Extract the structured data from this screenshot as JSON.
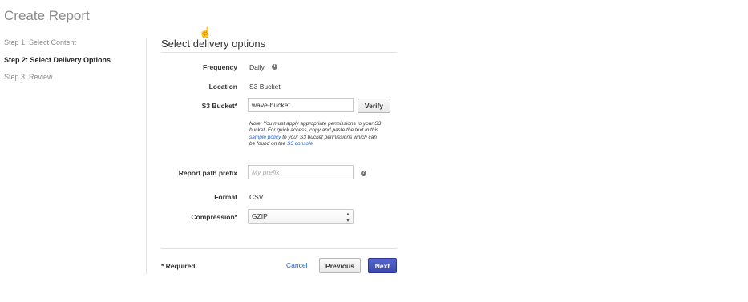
{
  "page": {
    "title": "Create Report"
  },
  "steps": [
    {
      "label": "Step 1: Select Content",
      "active": false
    },
    {
      "label": "Step 2: Select Delivery Options",
      "active": true
    },
    {
      "label": "Step 3: Review",
      "active": false
    }
  ],
  "section": {
    "title": "Select delivery options"
  },
  "form": {
    "frequency": {
      "label": "Frequency",
      "value": "Daily",
      "icon": "info-icon"
    },
    "location": {
      "label": "Location",
      "value": "S3 Bucket"
    },
    "bucket": {
      "label": "S3 Bucket*",
      "value": "wave-bucket",
      "verify_label": "Verify"
    },
    "note": {
      "before": "Note: You must apply appropriate permissions to your S3 bucket. For quick access, copy and paste the text in this ",
      "link1": "sample policy",
      "middle": " to your S3 bucket permissions which can be found on the ",
      "link2": "S3 console",
      "after": "."
    },
    "prefix": {
      "label": "Report path prefix",
      "placeholder": "My prefix",
      "icon": "help-icon"
    },
    "format": {
      "label": "Format",
      "value": "CSV"
    },
    "compression": {
      "label": "Compression*",
      "selected": "GZIP"
    }
  },
  "footer": {
    "required": "* Required",
    "cancel": "Cancel",
    "previous": "Previous",
    "next": "Next"
  },
  "colors": {
    "primary": "#3c4aaf",
    "link": "#1f5fc6"
  }
}
